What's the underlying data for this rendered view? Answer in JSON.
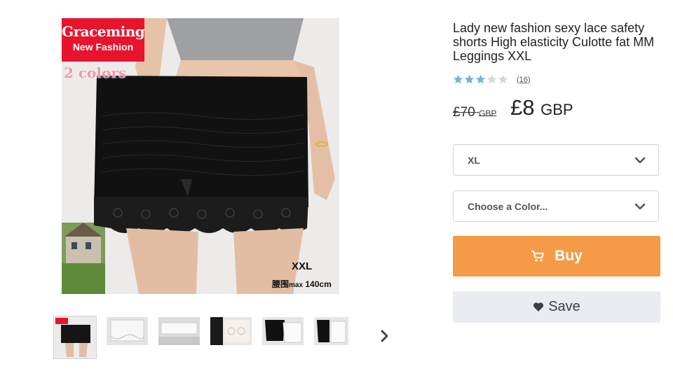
{
  "product": {
    "title": "Lady new fashion sexy lace safety shorts High elasticity Culotte fat MM Leggings XXL",
    "rating": {
      "stars": 3,
      "max": 5,
      "review_count": "(16)"
    },
    "old_price": {
      "amount": "£70",
      "currency": "GBP"
    },
    "price": {
      "amount": "£8",
      "currency": "GBP"
    }
  },
  "image": {
    "brand_line1": "Graceming",
    "brand_line2": "New Fashion",
    "colors_label": "2 colors",
    "size_label": "XXL",
    "waist_label_cn": "腰围",
    "waist_label_small": "max",
    "waist_label_value": "140cm"
  },
  "options": {
    "size_selected": "XL",
    "color_placeholder": "Choose a Color..."
  },
  "actions": {
    "buy_label": "Buy",
    "save_label": "Save"
  },
  "colors": {
    "buy": "#f59b48",
    "save_bg": "#e9edf1",
    "star_on": "#6fb4de",
    "star_off": "#d5d8db",
    "brand_red": "#e8132d"
  },
  "icons": {
    "buy": "cart-icon",
    "save": "heart-icon",
    "dropdown": "chevron-down-icon",
    "next": "chevron-right-icon"
  },
  "thumbnails": [
    "black-shorts",
    "white-lace-front",
    "white-lace-flat",
    "white-lace-detail",
    "black-and-white",
    "black-and-white-pair"
  ]
}
